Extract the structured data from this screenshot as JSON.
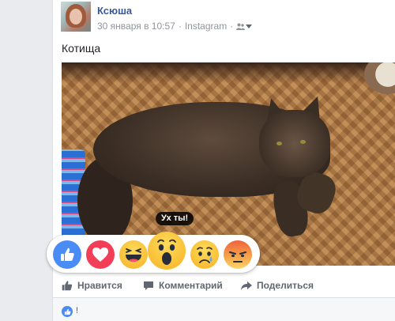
{
  "post": {
    "author": "Ксюша",
    "date": "30 января в 10:57",
    "separator": "·",
    "source": "Instagram",
    "text": "Котища"
  },
  "reaction_tooltip": "Ух ты!",
  "reactions": [
    {
      "name": "like-reaction",
      "icon": "thumbs-up-icon"
    },
    {
      "name": "love-reaction",
      "icon": "heart-icon"
    },
    {
      "name": "haha-reaction",
      "icon": "laughing-face-icon"
    },
    {
      "name": "wow-reaction",
      "icon": "surprised-face-icon"
    },
    {
      "name": "sad-reaction",
      "icon": "crying-face-icon"
    },
    {
      "name": "angry-reaction",
      "icon": "angry-face-icon"
    }
  ],
  "actions": {
    "like_label": "Нравится",
    "comment_label": "Комментарий",
    "share_label": "Поделиться"
  },
  "footer": {
    "mark": "!"
  },
  "colors": {
    "link": "#365899",
    "like_blue": "#4a8cf6",
    "love_red": "#f33e58",
    "emoji_yellow": "#fedb5a"
  }
}
